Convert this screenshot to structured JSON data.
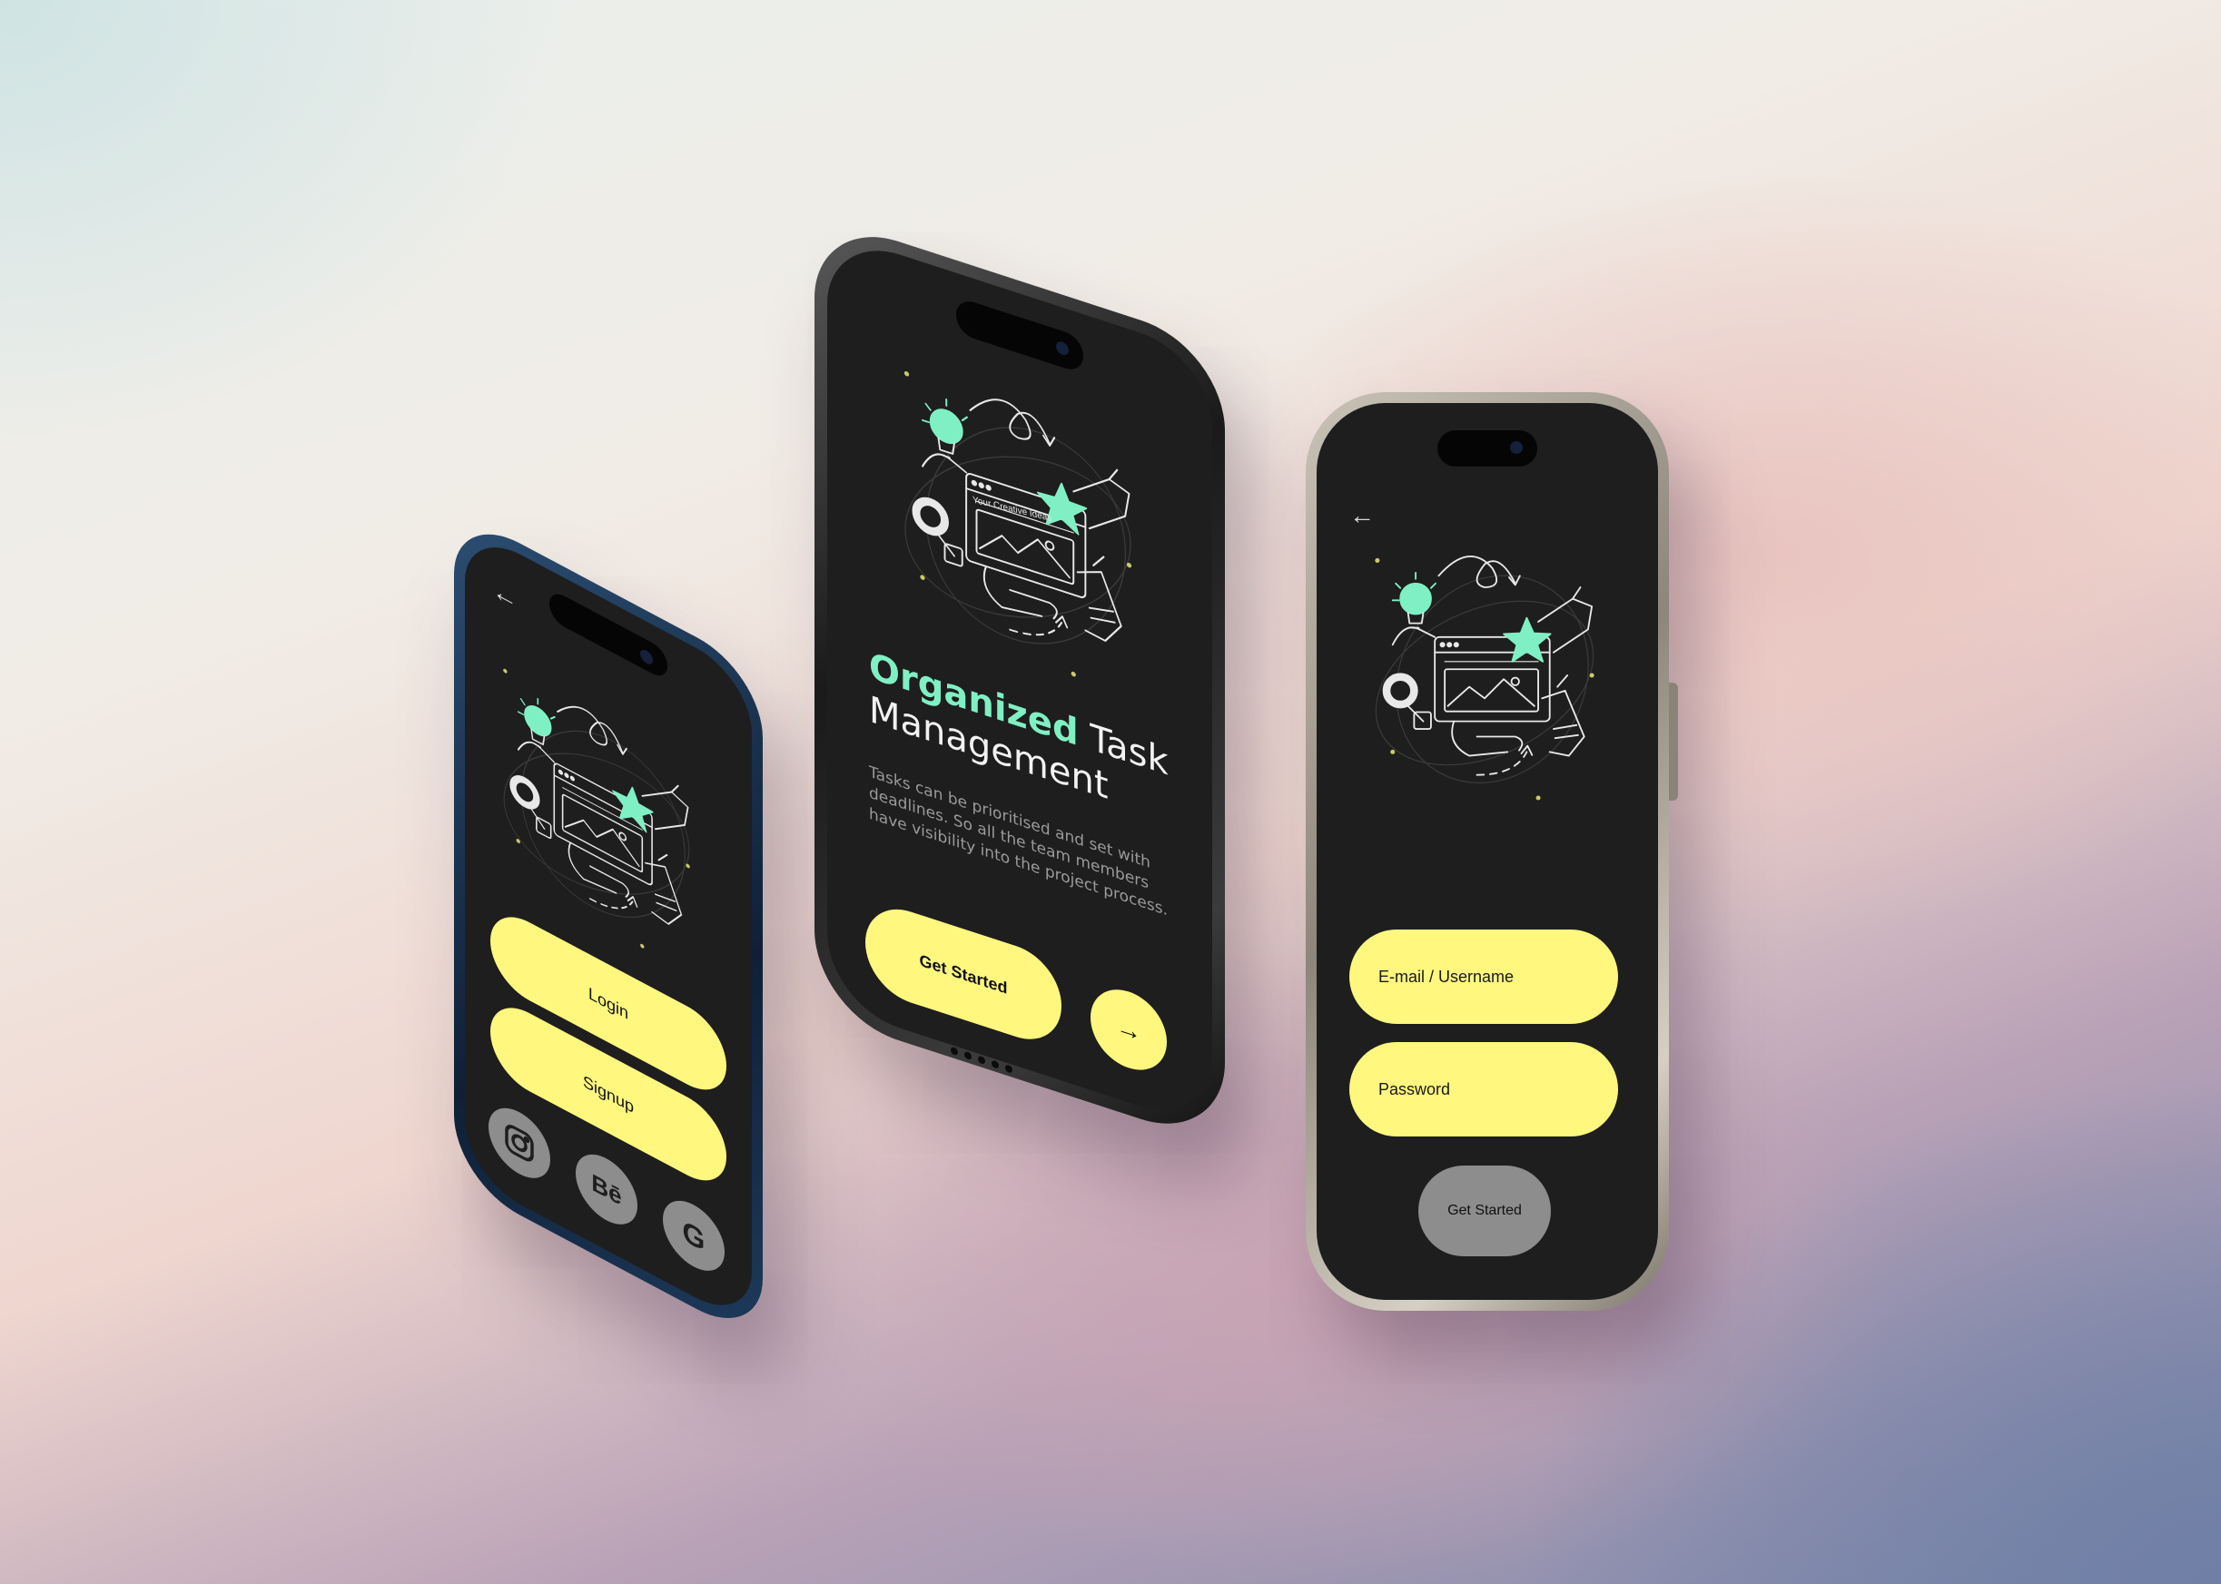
{
  "colors": {
    "screen_bg": "#1e1e1e",
    "accent_yellow": "#fff77e",
    "accent_mint": "#7ff0c4",
    "muted_gray": "#8d8d8d"
  },
  "left_phone": {
    "back_icon": "arrow-left-icon",
    "login_label": "Login",
    "signup_label": "Signup",
    "social": [
      {
        "name": "instagram",
        "icon": "instagram-icon"
      },
      {
        "name": "behance",
        "icon": "behance-icon",
        "glyph": "Bē"
      },
      {
        "name": "google",
        "icon": "google-icon",
        "glyph": "G"
      }
    ]
  },
  "center_phone": {
    "illustration_caption": "Your Creative Ideas",
    "headline_accent": "Organized",
    "headline_rest_1": " Task",
    "headline_rest_2": "Management",
    "description": "Tasks can be prioritised and set with deadlines. So all the team members have visibility into the project process.",
    "get_started_label": "Get Started",
    "next_icon": "arrow-right-icon"
  },
  "right_phone": {
    "back_icon": "arrow-left-icon",
    "email_placeholder": "E-mail / Username",
    "password_placeholder": "Password",
    "get_started_label": "Get Started"
  }
}
